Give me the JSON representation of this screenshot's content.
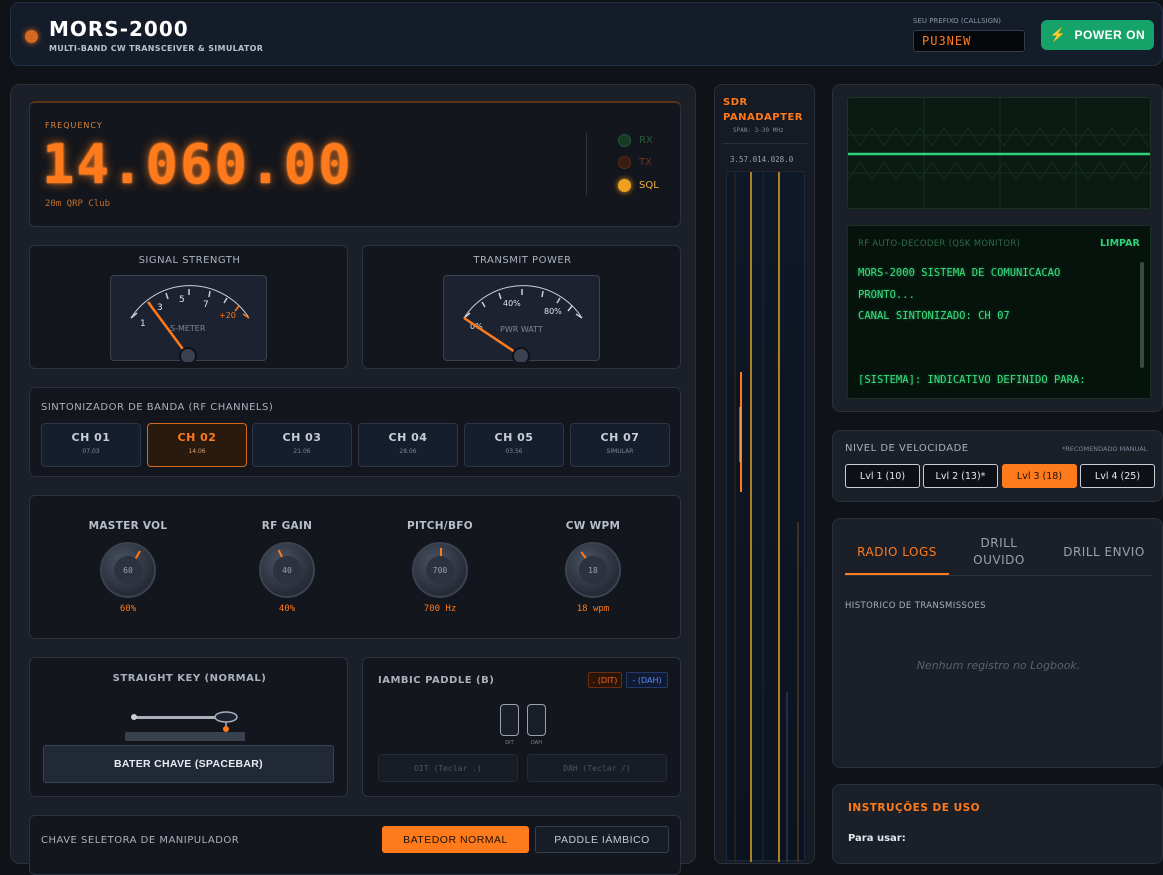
{
  "header": {
    "title": "MORS-2000",
    "subtitle": "MULTI-BAND CW TRANSCEIVER & SIMULATOR",
    "callsign_label": "SEU PREFIXO (CALLSIGN)",
    "callsign_value": "PU3NEW",
    "power_label": "POWER ON",
    "power_icon": "lightning-icon"
  },
  "frequency": {
    "label": "FREQUENCY",
    "value": "14.060.00",
    "club": "20m QRP Club",
    "indicators": [
      {
        "label": "RX",
        "color": "#1f4a2a"
      },
      {
        "label": "TX",
        "color": "#4a2516"
      },
      {
        "label": "SQL",
        "color": "#f0a020"
      }
    ]
  },
  "meters": {
    "signal": {
      "title": "SIGNAL STRENGTH",
      "unit": "S-METER",
      "scale": [
        "1",
        "3",
        "5",
        "7",
        "+20"
      ]
    },
    "power": {
      "title": "TRANSMIT POWER",
      "unit": "PWR WATT",
      "scale": [
        "0%",
        "40%",
        "80%"
      ]
    }
  },
  "band": {
    "title": "SINTONIZADOR DE BANDA (RF CHANNELS)",
    "channels": [
      {
        "name": "CH 01",
        "freq": "07.03",
        "active": false
      },
      {
        "name": "CH 02",
        "freq": "14.06",
        "active": true
      },
      {
        "name": "CH 03",
        "freq": "21.06",
        "active": false
      },
      {
        "name": "CH 04",
        "freq": "28.06",
        "active": false
      },
      {
        "name": "CH 05",
        "freq": "03.56",
        "active": false
      },
      {
        "name": "CH 07",
        "freq": "SIMULAR",
        "active": false
      }
    ]
  },
  "knobs": [
    {
      "label": "MASTER VOL",
      "inner": "60",
      "value": "60%",
      "level": 0.6
    },
    {
      "label": "RF GAIN",
      "inner": "40",
      "value": "40%",
      "level": 0.4
    },
    {
      "label": "PITCH/BFO",
      "inner": "700",
      "value": "700 Hz",
      "level": 0.5
    },
    {
      "label": "CW WPM",
      "inner": "18",
      "value": "18 wpm",
      "level": 0.3
    }
  ],
  "straight_key": {
    "title": "STRAIGHT KEY (NORMAL)",
    "button": "BATER CHAVE (SPACEBAR)"
  },
  "iambic": {
    "title": "IAMBIC PADDLE (B)",
    "dit_tag": ". (DIT)",
    "dah_tag": "- (DAH)",
    "dit_small": "DIT",
    "dah_small": "DAH",
    "dit_field": "DIT (Teclar .)",
    "dah_field": "DAH (Teclar /)"
  },
  "selector": {
    "title": "CHAVE SELETORA DE MANIPULADOR",
    "normal": "BATEDOR NORMAL",
    "iambic": "PADDLE IÁMBICO"
  },
  "sdr": {
    "title_line1": "SDR",
    "title_line2": "PANADAPTER",
    "span": "SPAN: 3-30 MHz",
    "readout": "3.57.014.028.0"
  },
  "decoder": {
    "title": "RF AUTO-DECODER (QSK MONITOR)",
    "clear": "LIMPAR",
    "line1": "MORS-2000 SISTEMA DE COMUNICACAO",
    "line2": "PRONTO...",
    "line3": "CANAL SINTONIZADO: CH 07",
    "line4": "[SISTEMA]: INDICATIVO DEFINIDO PARA:"
  },
  "speed": {
    "title": "NIVEL DE VELOCIDADE",
    "note": "*RECOMENDADO MANUAL",
    "levels": [
      {
        "label": "Lvl 1 (10)",
        "active": false
      },
      {
        "label": "Lvl 2 (13)*",
        "active": false
      },
      {
        "label": "Lvl 3 (18)",
        "active": true
      },
      {
        "label": "Lvl 4 (25)",
        "active": false
      }
    ]
  },
  "logs": {
    "tabs": [
      "RADIO LOGS",
      "DRILL OUVIDO",
      "DRILL ENVIO"
    ],
    "tab2_line1": "DRILL",
    "tab2_line2": "OUVIDO",
    "history_title": "HISTORICO DE TRANSMISSOES",
    "empty": "Nenhum registro no Logbook."
  },
  "help": {
    "title": "INSTRUÇÕES DE USO",
    "subtitle": "Para usar:"
  },
  "colors": {
    "accent": "#ff7a1a",
    "power": "#16a36a",
    "decoder_text": "#39e07e"
  }
}
